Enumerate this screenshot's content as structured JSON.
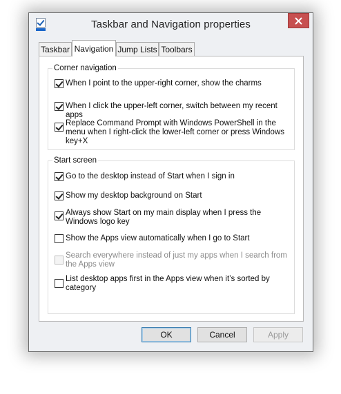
{
  "window": {
    "title": "Taskbar and Navigation properties",
    "close_glyph": "✕"
  },
  "tabs": [
    {
      "label": "Taskbar",
      "active": false
    },
    {
      "label": "Navigation",
      "active": true
    },
    {
      "label": "Jump Lists",
      "active": false
    },
    {
      "label": "Toolbars",
      "active": false
    }
  ],
  "corner_navigation": {
    "label": "Corner navigation",
    "options": [
      {
        "text": "When I point to the upper-right corner, show the charms",
        "checked": true,
        "enabled": true
      },
      {
        "text": "When I click the upper-left corner, switch between my recent apps",
        "checked": true,
        "enabled": true
      },
      {
        "text": "Replace Command Prompt with Windows PowerShell in the menu when I right-click the lower-left corner or press Windows key+X",
        "checked": true,
        "enabled": true
      }
    ]
  },
  "start_screen": {
    "label": "Start screen",
    "options": [
      {
        "text": "Go to the desktop instead of Start when I sign in",
        "checked": true,
        "enabled": true
      },
      {
        "text": "Show my desktop background on Start",
        "checked": true,
        "enabled": true
      },
      {
        "text": "Always show Start on my main display when I press the Windows logo key",
        "checked": true,
        "enabled": true
      },
      {
        "text": "Show the Apps view automatically when I go to Start",
        "checked": false,
        "enabled": true
      },
      {
        "text": "Search everywhere instead of just my apps when I search from the Apps view",
        "checked": false,
        "enabled": false
      },
      {
        "text": "List desktop apps first in the Apps view when it’s sorted by category",
        "checked": false,
        "enabled": true
      }
    ]
  },
  "buttons": {
    "ok": "OK",
    "cancel": "Cancel",
    "apply": "Apply"
  }
}
